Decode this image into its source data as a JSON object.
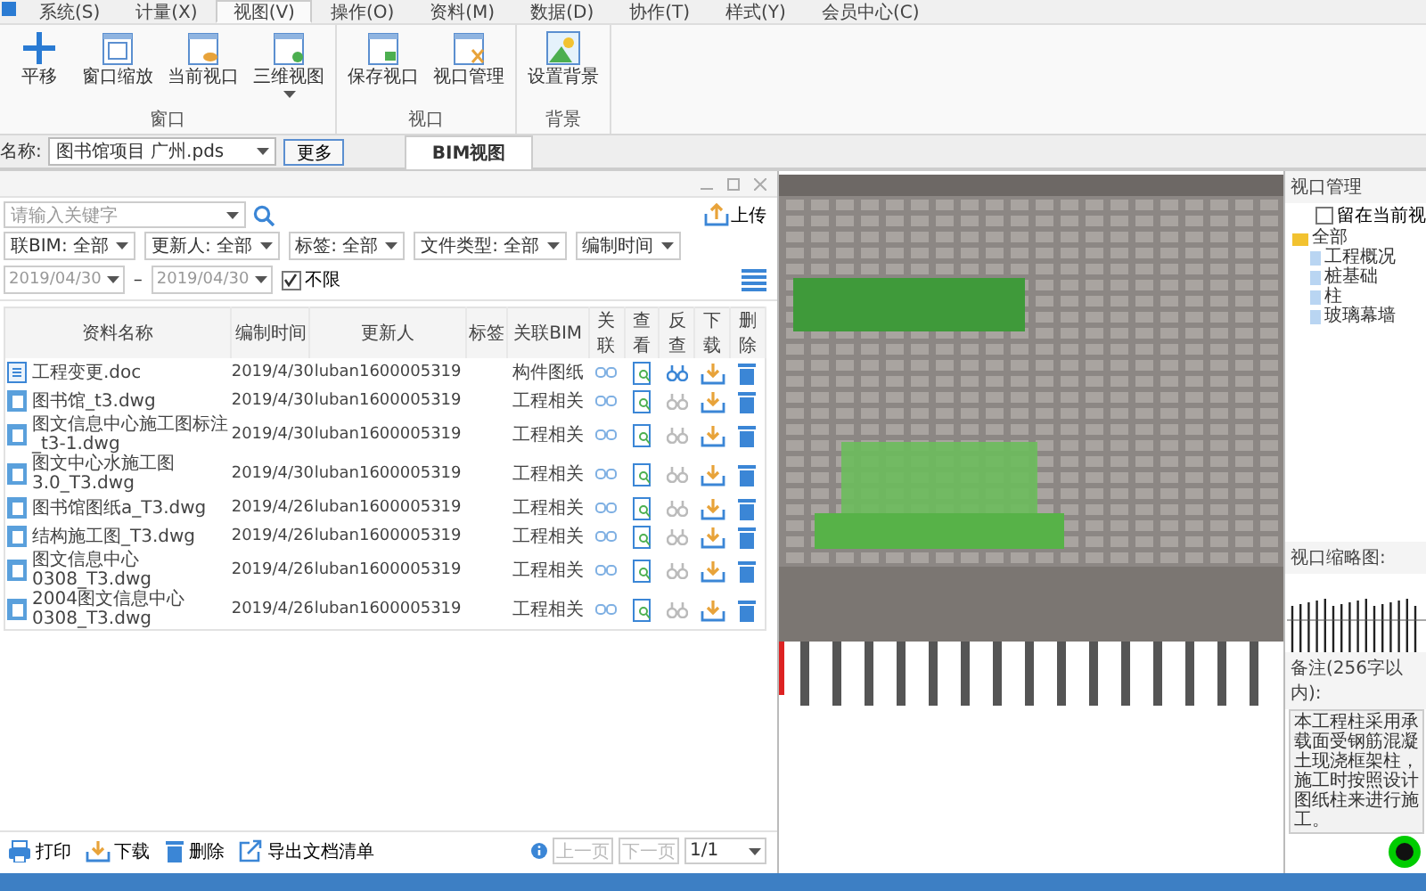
{
  "menu": {
    "tabs": [
      {
        "label": "系统(S)",
        "selected": false
      },
      {
        "label": "计量(X)",
        "selected": false
      },
      {
        "label": "视图(V)",
        "selected": true
      },
      {
        "label": "操作(O)",
        "selected": false
      },
      {
        "label": "资料(M)",
        "selected": false
      },
      {
        "label": "数据(D)",
        "selected": false
      },
      {
        "label": "协作(T)",
        "selected": false
      },
      {
        "label": "样式(Y)",
        "selected": false
      },
      {
        "label": "会员中心(C)",
        "selected": false
      }
    ]
  },
  "ribbon": {
    "groups": [
      {
        "label": "窗口",
        "buttons": [
          {
            "label": "平移",
            "kind": "pan",
            "dropdown": false
          },
          {
            "label": "窗口缩放",
            "kind": "window",
            "dropdown": false
          },
          {
            "label": "当前视口",
            "kind": "eye",
            "dropdown": false
          },
          {
            "label": "三维视图",
            "kind": "dot",
            "dropdown": true
          }
        ]
      },
      {
        "label": "视口",
        "buttons": [
          {
            "label": "保存视口",
            "kind": "save",
            "dropdown": false
          },
          {
            "label": "视口管理",
            "kind": "manage",
            "dropdown": false
          }
        ]
      },
      {
        "label": "背景",
        "buttons": [
          {
            "label": "设置背景",
            "kind": "picture",
            "dropdown": false
          }
        ]
      }
    ]
  },
  "project_bar": {
    "label": "名称:",
    "value": "图书馆项目 广州.pds",
    "button": "更多"
  },
  "view_tabs": [
    {
      "label": "BIM视图",
      "selected": true
    }
  ],
  "file_panel": {
    "search": {
      "placeholder": "请输入关键字"
    },
    "upload": "上传",
    "filters": [
      {
        "label": "联BIM: 全部"
      },
      {
        "label": "更新人: 全部"
      },
      {
        "label": "标签: 全部"
      },
      {
        "label": "文件类型: 全部"
      }
    ],
    "date_filter": {
      "label": "编制时间",
      "from": "2019/04/30",
      "separator": "–",
      "to": "2019/04/30"
    },
    "unlimited": {
      "label": "不限",
      "checked": true
    },
    "columns": [
      "资料名称",
      "编制时间",
      "更新人",
      "标签",
      "关联BIM",
      "关联",
      "查看",
      "反查",
      "下载",
      "删除"
    ],
    "rows": [
      {
        "name": "工程变更.doc",
        "kind": "doc",
        "time": "2019/4/30",
        "updater": "luban1600005319",
        "bim": "构件图纸",
        "reverse_lookup_active": true
      },
      {
        "name": "图书馆_t3.dwg",
        "kind": "dwg",
        "time": "2019/4/30",
        "updater": "luban1600005319",
        "bim": "工程相关",
        "reverse_lookup_active": false
      },
      {
        "name": "图文信息中心施工图标注_t3-1.dwg",
        "kind": "dwg",
        "time": "2019/4/30",
        "updater": "luban1600005319",
        "bim": "工程相关",
        "reverse_lookup_active": false
      },
      {
        "name": "图文中心水施工图3.0_T3.dwg",
        "kind": "dwg",
        "time": "2019/4/30",
        "updater": "luban1600005319",
        "bim": "工程相关",
        "reverse_lookup_active": false
      },
      {
        "name": "图书馆图纸a_T3.dwg",
        "kind": "dwg",
        "time": "2019/4/26",
        "updater": "luban1600005319",
        "bim": "工程相关",
        "reverse_lookup_active": false
      },
      {
        "name": "结构施工图_T3.dwg",
        "kind": "dwg",
        "time": "2019/4/26",
        "updater": "luban1600005319",
        "bim": "工程相关",
        "reverse_lookup_active": false
      },
      {
        "name": "图文信息中心0308_T3.dwg",
        "kind": "dwg",
        "time": "2019/4/26",
        "updater": "luban1600005319",
        "bim": "工程相关",
        "reverse_lookup_active": false
      },
      {
        "name": "2004图文信息中心0308_T3.dwg",
        "kind": "dwg",
        "time": "2019/4/26",
        "updater": "luban1600005319",
        "bim": "工程相关",
        "reverse_lookup_active": false
      }
    ],
    "actions": [
      {
        "label": "打印",
        "kind": "print"
      },
      {
        "label": "下载",
        "kind": "download"
      },
      {
        "label": "删除",
        "kind": "delete"
      },
      {
        "label": "导出文档清单",
        "kind": "export"
      }
    ],
    "pagination": {
      "prev": "上一页",
      "next": "下一页",
      "disabled": true,
      "page": "1/1"
    }
  },
  "side_panel": {
    "title": "视口管理",
    "stay": {
      "label": "留在当前视",
      "checked": false
    },
    "tree": [
      {
        "label": "全部",
        "expanded": true,
        "children": [
          {
            "label": "工程概况"
          },
          {
            "label": "桩基础"
          },
          {
            "label": "柱"
          },
          {
            "label": "玻璃幕墙"
          }
        ]
      }
    ],
    "thumbnail_label": "视口缩略图:",
    "remark_label": "备注(256字以内):",
    "remark": "本工程柱采用承载面受钢筋混凝土现浇框架柱，施工时按照设计图纸柱来进行施工。"
  }
}
